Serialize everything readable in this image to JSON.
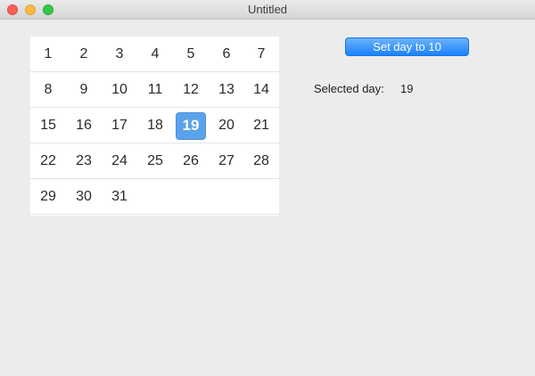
{
  "window": {
    "title": "Untitled"
  },
  "calendar": {
    "weeks": [
      [
        "1",
        "2",
        "3",
        "4",
        "5",
        "6",
        "7"
      ],
      [
        "8",
        "9",
        "10",
        "11",
        "12",
        "13",
        "14"
      ],
      [
        "15",
        "16",
        "17",
        "18",
        "19",
        "20",
        "21"
      ],
      [
        "22",
        "23",
        "24",
        "25",
        "26",
        "27",
        "28"
      ],
      [
        "29",
        "30",
        "31"
      ]
    ],
    "selected_day": "19",
    "accent_color": "#5aa2ec"
  },
  "controls": {
    "set_button_label": "Set day to 10",
    "selected_label": "Selected day:",
    "selected_value": "19"
  }
}
